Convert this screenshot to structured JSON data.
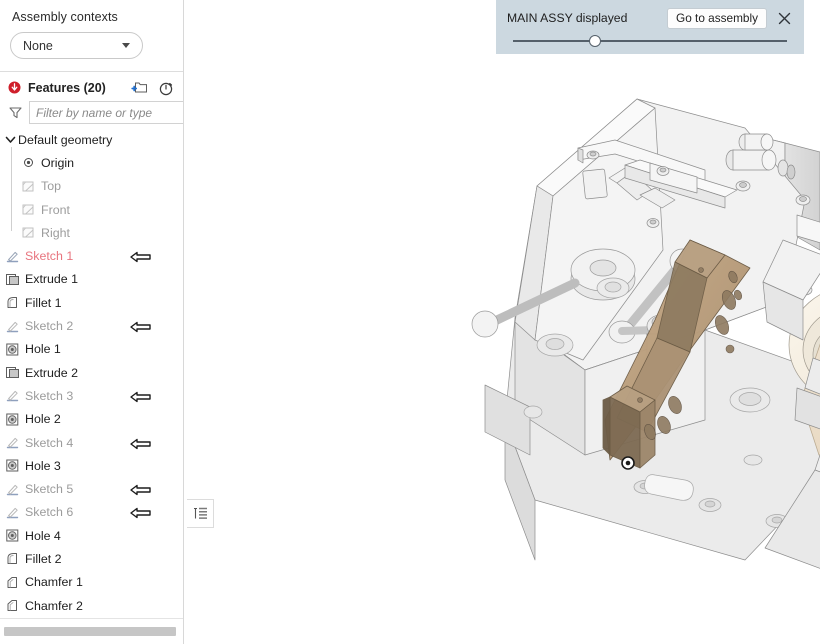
{
  "panel": {
    "assembly_contexts": {
      "title": "Assembly contexts",
      "selected": "None",
      "dropdown_icon": "chevron-down-icon"
    },
    "features": {
      "status_icon": "error-badge-icon",
      "title": "Features (20)",
      "new_folder_icon": "new-folder-icon",
      "history_icon": "stopwatch-icon",
      "filter_icon": "filter-funnel-icon",
      "filter_placeholder": "Filter by name or type",
      "filter_value": ""
    },
    "tree": [
      {
        "label": "Default geometry",
        "icon": "chevron-expanded-icon",
        "type": "folder",
        "state": "normal",
        "rollback": false,
        "indent": 0
      },
      {
        "label": "Origin",
        "icon": "origin-icon",
        "type": "origin",
        "state": "normal",
        "rollback": false,
        "indent": 1
      },
      {
        "label": "Top",
        "icon": "plane-icon",
        "type": "plane",
        "state": "hidden",
        "rollback": false,
        "indent": 1
      },
      {
        "label": "Front",
        "icon": "plane-icon",
        "type": "plane",
        "state": "hidden",
        "rollback": false,
        "indent": 1
      },
      {
        "label": "Right",
        "icon": "plane-icon",
        "type": "plane",
        "state": "hidden",
        "rollback": false,
        "indent": 1
      },
      {
        "label": "Sketch 1",
        "icon": "sketch-icon",
        "type": "sketch",
        "state": "error",
        "rollback": true,
        "indent": 0
      },
      {
        "label": "Extrude 1",
        "icon": "extrude-icon",
        "type": "extrude",
        "state": "normal",
        "rollback": false,
        "indent": 0
      },
      {
        "label": "Fillet 1",
        "icon": "fillet-icon",
        "type": "fillet",
        "state": "normal",
        "rollback": false,
        "indent": 0
      },
      {
        "label": "Sketch 2",
        "icon": "sketch-icon",
        "type": "sketch",
        "state": "hidden",
        "rollback": true,
        "indent": 0
      },
      {
        "label": "Hole 1",
        "icon": "hole-icon",
        "type": "hole",
        "state": "normal",
        "rollback": false,
        "indent": 0
      },
      {
        "label": "Extrude 2",
        "icon": "extrude-icon",
        "type": "extrude",
        "state": "normal",
        "rollback": false,
        "indent": 0
      },
      {
        "label": "Sketch 3",
        "icon": "sketch-icon",
        "type": "sketch",
        "state": "hidden",
        "rollback": true,
        "indent": 0
      },
      {
        "label": "Hole 2",
        "icon": "hole-icon",
        "type": "hole",
        "state": "normal",
        "rollback": false,
        "indent": 0
      },
      {
        "label": "Sketch 4",
        "icon": "sketch-icon",
        "type": "sketch",
        "state": "hidden",
        "rollback": true,
        "indent": 0
      },
      {
        "label": "Hole 3",
        "icon": "hole-icon",
        "type": "hole",
        "state": "normal",
        "rollback": false,
        "indent": 0
      },
      {
        "label": "Sketch 5",
        "icon": "sketch-icon",
        "type": "sketch",
        "state": "hidden",
        "rollback": true,
        "indent": 0
      },
      {
        "label": "Sketch 6",
        "icon": "sketch-icon",
        "type": "sketch",
        "state": "hidden",
        "rollback": true,
        "indent": 0
      },
      {
        "label": "Hole 4",
        "icon": "hole-icon",
        "type": "hole",
        "state": "normal",
        "rollback": false,
        "indent": 0
      },
      {
        "label": "Fillet 2",
        "icon": "fillet-icon",
        "type": "fillet",
        "state": "normal",
        "rollback": false,
        "indent": 0
      },
      {
        "label": "Chamfer 1",
        "icon": "chamfer-icon",
        "type": "chamfer",
        "state": "normal",
        "rollback": false,
        "indent": 0
      },
      {
        "label": "Chamfer 2",
        "icon": "chamfer-icon",
        "type": "chamfer",
        "state": "normal",
        "rollback": false,
        "indent": 0
      }
    ],
    "list_toggle_icon": "feature-list-toggle-icon",
    "horizontal_scrollbar": "horizontal-scrollbar"
  },
  "assembly_banner": {
    "label": "MAIN ASSY displayed",
    "go_to_assembly_label": "Go to assembly",
    "close_icon": "close-icon",
    "slider": {
      "name": "assembly-transparency-slider",
      "position_percent": 29
    },
    "background_color": "#ccd8e0"
  },
  "graphics": {
    "name": "3d-model-viewport",
    "background_color": "#ffffff",
    "selected_part_color": "#c0a484",
    "body_color": "#ededed",
    "accent_part_color": "#f0e4d4"
  }
}
